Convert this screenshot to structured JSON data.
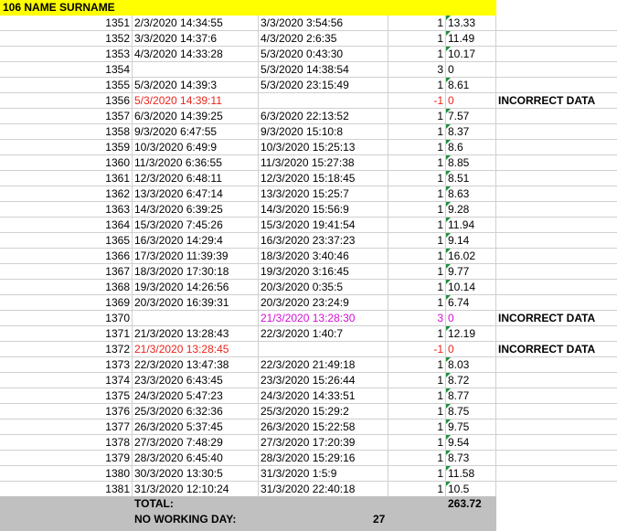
{
  "header": {
    "title": "106 NAME SURNAME",
    "color": "#ffff00"
  },
  "colors": {
    "error_red": "#e8251c",
    "magenta": "#d40fd4",
    "footer_gray": "#c0c0c0"
  },
  "rows": [
    {
      "n": "1351",
      "start": "2/3/2020 14:34:55",
      "end": "3/3/2020 3:54:56",
      "flag": "1",
      "hours": "13.33",
      "note": "",
      "style": ""
    },
    {
      "n": "1352",
      "start": "3/3/2020 14:37:6",
      "end": "4/3/2020 2:6:35",
      "flag": "1",
      "hours": "11.49",
      "note": "",
      "style": ""
    },
    {
      "n": "1353",
      "start": "4/3/2020 14:33:28",
      "end": "5/3/2020 0:43:30",
      "flag": "1",
      "hours": "10.17",
      "note": "",
      "style": ""
    },
    {
      "n": "1354",
      "start": "",
      "end": "5/3/2020 14:38:54",
      "flag": "3",
      "hours": "0",
      "note": "",
      "style": ""
    },
    {
      "n": "1355",
      "start": "5/3/2020 14:39:3",
      "end": "5/3/2020 23:15:49",
      "flag": "1",
      "hours": "8.61",
      "note": "",
      "style": ""
    },
    {
      "n": "1356",
      "start": "5/3/2020 14:39:11",
      "end": "",
      "flag": "-1",
      "hours": "0",
      "note": "INCORRECT DATA",
      "style": "red"
    },
    {
      "n": "1357",
      "start": "6/3/2020 14:39:25",
      "end": "6/3/2020 22:13:52",
      "flag": "1",
      "hours": "7.57",
      "note": "",
      "style": ""
    },
    {
      "n": "1358",
      "start": "9/3/2020 6:47:55",
      "end": "9/3/2020 15:10:8",
      "flag": "1",
      "hours": "8.37",
      "note": "",
      "style": ""
    },
    {
      "n": "1359",
      "start": "10/3/2020 6:49:9",
      "end": "10/3/2020 15:25:13",
      "flag": "1",
      "hours": "8.6",
      "note": "",
      "style": ""
    },
    {
      "n": "1360",
      "start": "11/3/2020 6:36:55",
      "end": "11/3/2020 15:27:38",
      "flag": "1",
      "hours": "8.85",
      "note": "",
      "style": ""
    },
    {
      "n": "1361",
      "start": "12/3/2020 6:48:11",
      "end": "12/3/2020 15:18:45",
      "flag": "1",
      "hours": "8.51",
      "note": "",
      "style": ""
    },
    {
      "n": "1362",
      "start": "13/3/2020 6:47:14",
      "end": "13/3/2020 15:25:7",
      "flag": "1",
      "hours": "8.63",
      "note": "",
      "style": ""
    },
    {
      "n": "1363",
      "start": "14/3/2020 6:39:25",
      "end": "14/3/2020 15:56:9",
      "flag": "1",
      "hours": "9.28",
      "note": "",
      "style": ""
    },
    {
      "n": "1364",
      "start": "15/3/2020 7:45:26",
      "end": "15/3/2020 19:41:54",
      "flag": "1",
      "hours": "11.94",
      "note": "",
      "style": ""
    },
    {
      "n": "1365",
      "start": "16/3/2020 14:29:4",
      "end": "16/3/2020 23:37:23",
      "flag": "1",
      "hours": "9.14",
      "note": "",
      "style": ""
    },
    {
      "n": "1366",
      "start": "17/3/2020 11:39:39",
      "end": "18/3/2020 3:40:46",
      "flag": "1",
      "hours": "16.02",
      "note": "",
      "style": ""
    },
    {
      "n": "1367",
      "start": "18/3/2020 17:30:18",
      "end": "19/3/2020 3:16:45",
      "flag": "1",
      "hours": "9.77",
      "note": "",
      "style": ""
    },
    {
      "n": "1368",
      "start": "19/3/2020 14:26:56",
      "end": "20/3/2020 0:35:5",
      "flag": "1",
      "hours": "10.14",
      "note": "",
      "style": ""
    },
    {
      "n": "1369",
      "start": "20/3/2020 16:39:31",
      "end": "20/3/2020 23:24:9",
      "flag": "1",
      "hours": "6.74",
      "note": "",
      "style": ""
    },
    {
      "n": "1370",
      "start": "",
      "end": "21/3/2020 13:28:30",
      "flag": "3",
      "hours": "0",
      "note": "INCORRECT DATA",
      "style": "magenta"
    },
    {
      "n": "1371",
      "start": "21/3/2020 13:28:43",
      "end": "22/3/2020 1:40:7",
      "flag": "1",
      "hours": "12.19",
      "note": "",
      "style": ""
    },
    {
      "n": "1372",
      "start": "21/3/2020 13:28:45",
      "end": "",
      "flag": "-1",
      "hours": "0",
      "note": "INCORRECT DATA",
      "style": "red"
    },
    {
      "n": "1373",
      "start": "22/3/2020 13:47:38",
      "end": "22/3/2020 21:49:18",
      "flag": "1",
      "hours": "8.03",
      "note": "",
      "style": ""
    },
    {
      "n": "1374",
      "start": "23/3/2020 6:43:45",
      "end": "23/3/2020 15:26:44",
      "flag": "1",
      "hours": "8.72",
      "note": "",
      "style": ""
    },
    {
      "n": "1375",
      "start": "24/3/2020 5:47:23",
      "end": "24/3/2020 14:33:51",
      "flag": "1",
      "hours": "8.77",
      "note": "",
      "style": ""
    },
    {
      "n": "1376",
      "start": "25/3/2020 6:32:36",
      "end": "25/3/2020 15:29:2",
      "flag": "1",
      "hours": "8.75",
      "note": "",
      "style": ""
    },
    {
      "n": "1377",
      "start": "26/3/2020 5:37:45",
      "end": "26/3/2020 15:22:58",
      "flag": "1",
      "hours": "9.75",
      "note": "",
      "style": ""
    },
    {
      "n": "1378",
      "start": "27/3/2020 7:48:29",
      "end": "27/3/2020 17:20:39",
      "flag": "1",
      "hours": "9.54",
      "note": "",
      "style": ""
    },
    {
      "n": "1379",
      "start": "28/3/2020 6:45:40",
      "end": "28/3/2020 15:29:16",
      "flag": "1",
      "hours": "8.73",
      "note": "",
      "style": ""
    },
    {
      "n": "1380",
      "start": "30/3/2020 13:30:5",
      "end": "31/3/2020 1:5:9",
      "flag": "1",
      "hours": "11.58",
      "note": "",
      "style": ""
    },
    {
      "n": "1381",
      "start": "31/3/2020 12:10:24",
      "end": "31/3/2020 22:40:18",
      "flag": "1",
      "hours": "10.5",
      "note": "",
      "style": ""
    }
  ],
  "footer": {
    "total_label": "TOTAL:",
    "total_value": "263.72",
    "no_working_label": "NO WORKING DAY:",
    "no_working_value": "27"
  }
}
